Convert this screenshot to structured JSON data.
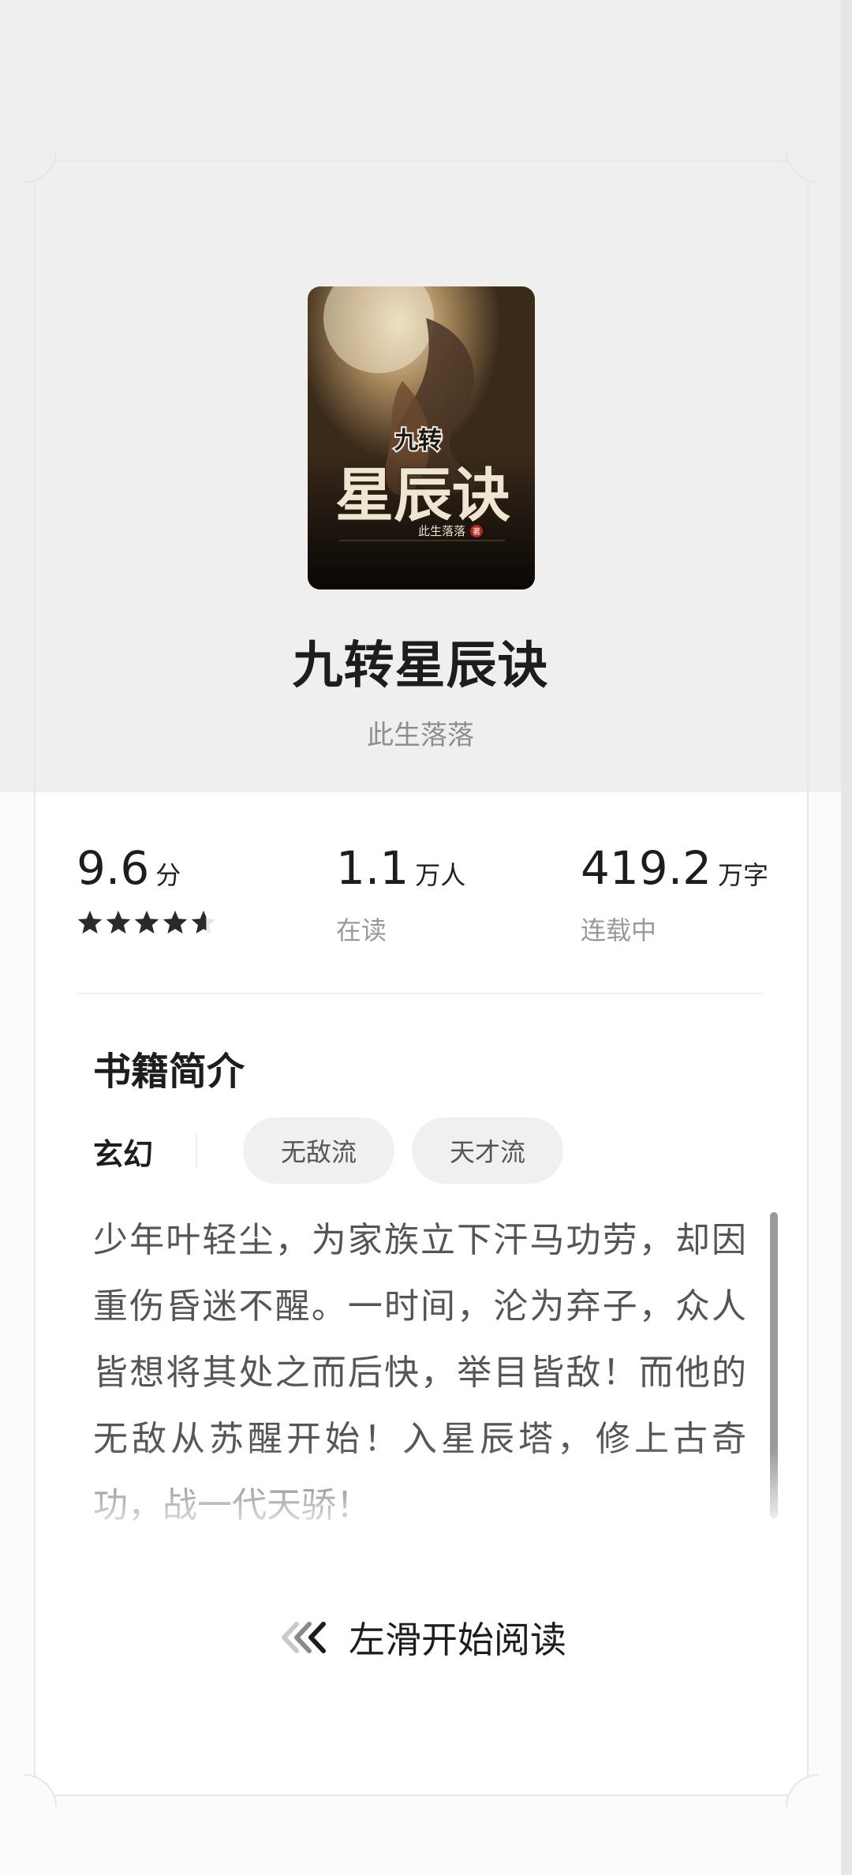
{
  "book": {
    "title": "九转星辰诀",
    "author": "此生落落",
    "cover": {
      "title_small": "九转",
      "title_big": "星辰诀",
      "author": "此生落落",
      "author_mark": "著"
    }
  },
  "stats": {
    "score": {
      "value": "9.6",
      "unit": "分",
      "stars_out_of_5": 4.6
    },
    "readers": {
      "value": "1.1",
      "unit": "万人",
      "label": "在读"
    },
    "words": {
      "value": "419.2",
      "unit": "万字",
      "label": "连载中"
    }
  },
  "intro": {
    "heading": "书籍简介",
    "category": "玄幻",
    "tags": [
      "无敌流",
      "天才流"
    ],
    "description": "少年叶轻尘，为家族立下汗马功劳，却因重伤昏迷不醒。一时间，沦为弃子，众人皆想将其处之而后快，举目皆敌！而他的无敌从苏醒开始！入星辰塔，修上古奇功，战一代天骄！"
  },
  "cta": {
    "label": "左滑开始阅读",
    "icon": "chevrons-left-icon"
  },
  "colors": {
    "text_primary": "#1d1d1d",
    "text_secondary": "#999999",
    "tag_bg": "#f0f0f0"
  }
}
